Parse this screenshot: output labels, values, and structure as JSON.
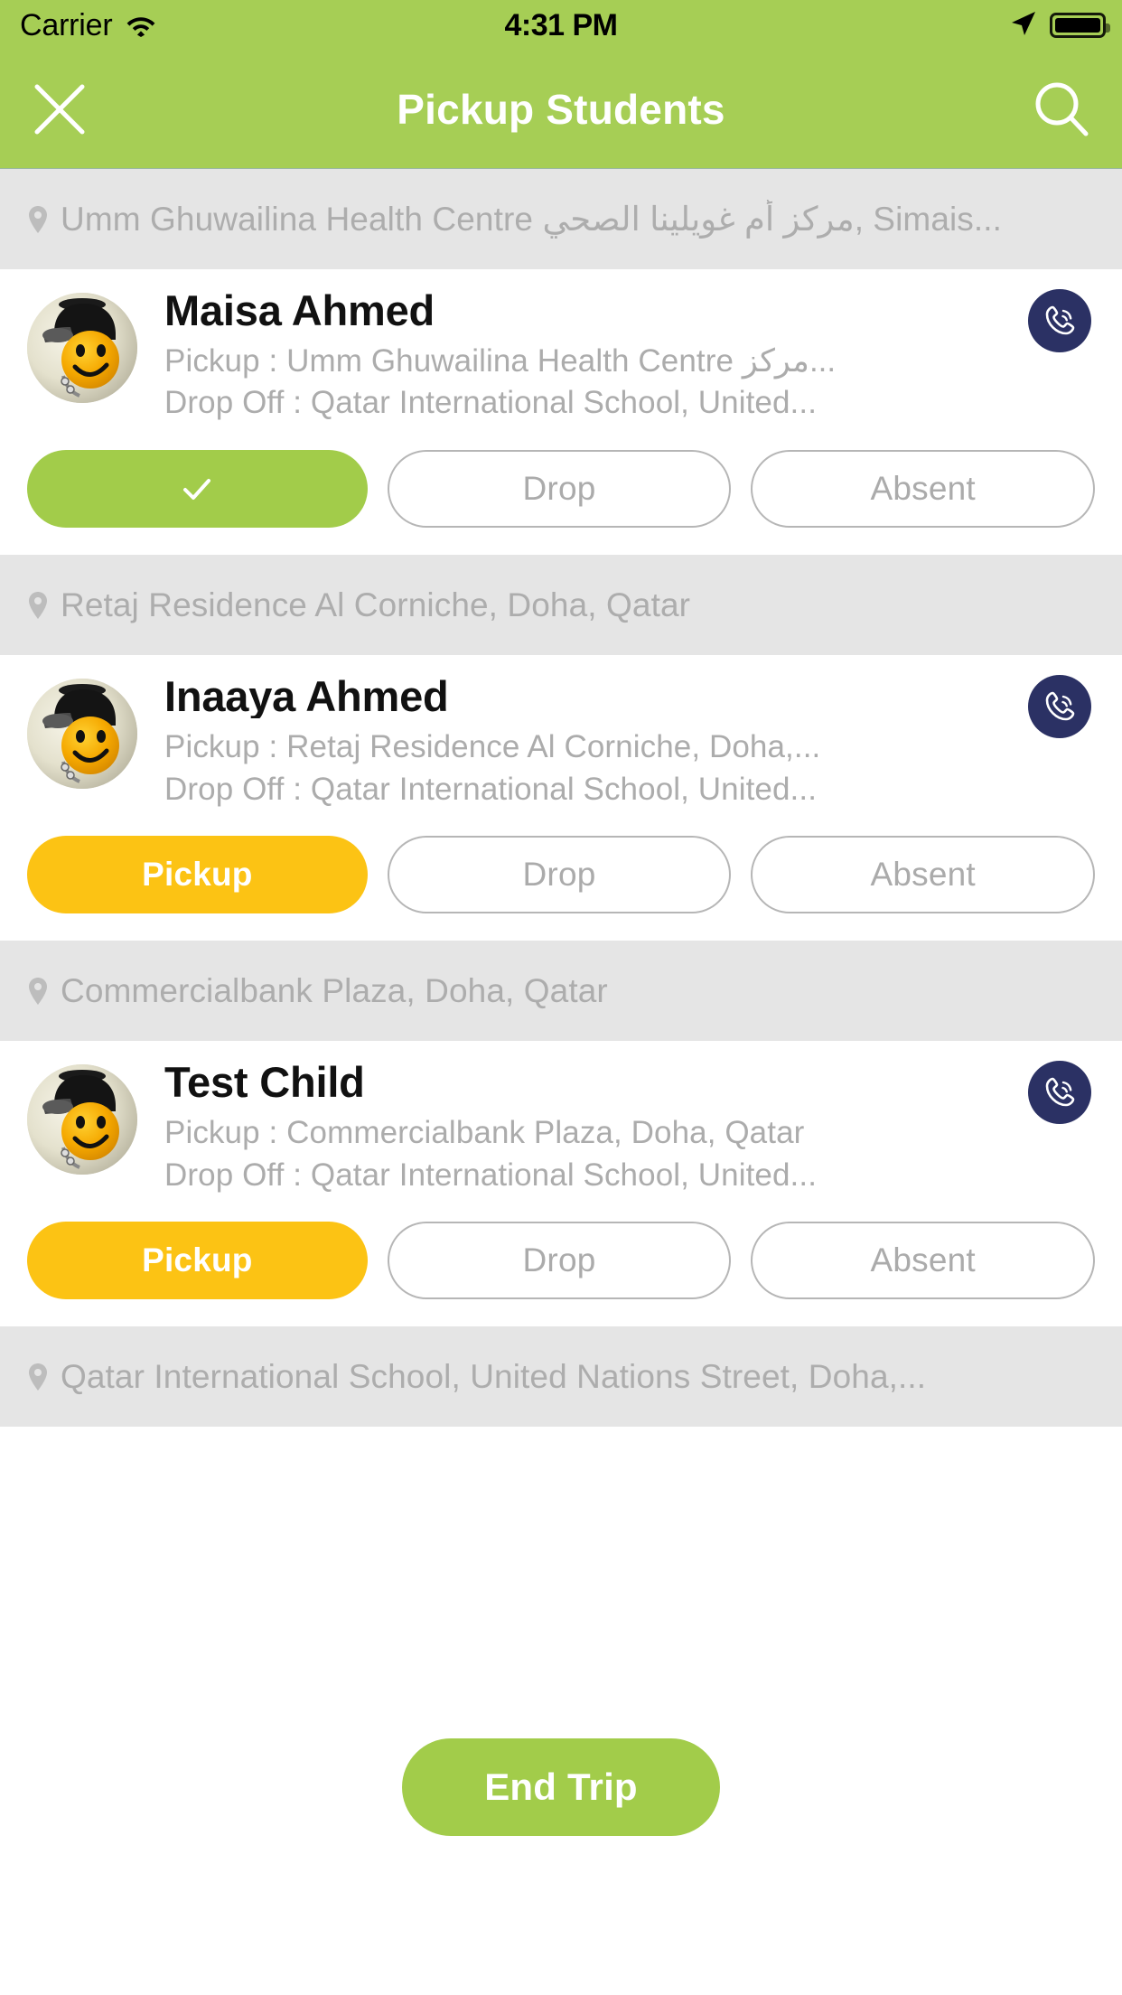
{
  "status_bar": {
    "carrier": "Carrier",
    "time": "4:31 PM",
    "wifi_icon": "wifi-icon",
    "location_arrow_icon": "location-arrow-icon",
    "battery_icon": "battery-full-icon"
  },
  "nav": {
    "close_icon": "close-icon",
    "title": "Pickup Students",
    "search_icon": "search-icon"
  },
  "colors": {
    "brand_green": "#A6CE55",
    "action_green": "#A2CC4A",
    "action_amber": "#FCC314",
    "call_navy": "#2B3164",
    "group_header_bg": "#E5E5E5",
    "muted_text": "#ACACAC"
  },
  "groups": [
    {
      "pin_icon": "map-pin-icon",
      "location": "Umm Ghuwailina Health Centre مركز أم غويلينا الصحي, Simais...",
      "student": {
        "avatar_icon": "smiley-cap-avatar",
        "name": "Maisa Ahmed",
        "pickup": "Pickup : Umm Ghuwailina Health Centre مركز...",
        "dropoff": "Drop Off : Qatar International School, United...",
        "call_icon": "phone-call-icon",
        "primary_action": {
          "state": "done",
          "label": "",
          "icon": "check-icon"
        },
        "drop_label": "Drop",
        "absent_label": "Absent"
      }
    },
    {
      "pin_icon": "map-pin-icon",
      "location": "Retaj Residence Al Corniche, Doha, Qatar",
      "student": {
        "avatar_icon": "smiley-cap-avatar",
        "name": "Inaaya Ahmed",
        "pickup": "Pickup : Retaj Residence Al Corniche, Doha,...",
        "dropoff": "Drop Off : Qatar International School, United...",
        "call_icon": "phone-call-icon",
        "primary_action": {
          "state": "pending",
          "label": "Pickup",
          "icon": ""
        },
        "drop_label": "Drop",
        "absent_label": "Absent"
      }
    },
    {
      "pin_icon": "map-pin-icon",
      "location": "Commercialbank Plaza, Doha, Qatar",
      "student": {
        "avatar_icon": "smiley-cap-avatar",
        "name": "Test Child",
        "pickup": "Pickup : Commercialbank Plaza, Doha, Qatar",
        "dropoff": "Drop Off : Qatar International School, United...",
        "call_icon": "phone-call-icon",
        "primary_action": {
          "state": "pending",
          "label": "Pickup",
          "icon": ""
        },
        "drop_label": "Drop",
        "absent_label": "Absent"
      }
    }
  ],
  "final_location": {
    "pin_icon": "map-pin-icon",
    "location": "Qatar International School, United Nations Street, Doha,..."
  },
  "footer": {
    "end_trip_label": "End Trip"
  }
}
